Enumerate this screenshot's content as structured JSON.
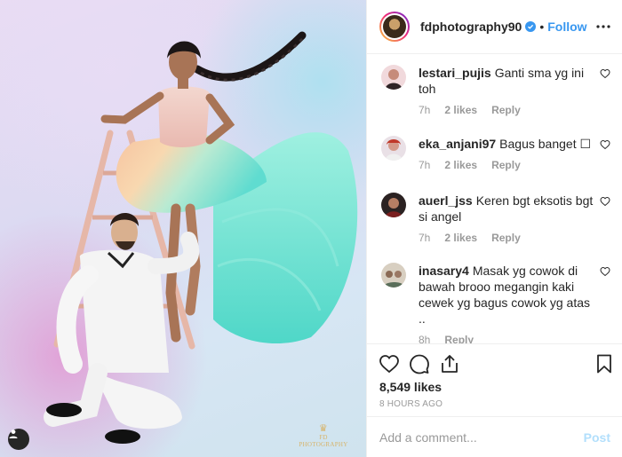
{
  "photo": {
    "alt_icon": "user-tag-icon",
    "watermark_text": "FD PHOTOGRAPHY"
  },
  "header": {
    "username": "fdphotography90",
    "verified_icon": "verified-badge-icon",
    "separator": "•",
    "follow_label": "Follow",
    "more_icon": "more-options-icon"
  },
  "comments": [
    {
      "username": "lestari_pujis",
      "text": "Ganti sma yg ini toh",
      "time": "7h",
      "likes": "2 likes",
      "reply_label": "Reply"
    },
    {
      "username": "eka_anjani97",
      "text": "Bagus banget ☐",
      "time": "7h",
      "likes": "2 likes",
      "reply_label": "Reply"
    },
    {
      "username": "auerl_jss",
      "text": "Keren bgt eksotis bgt si angel",
      "time": "7h",
      "likes": "2 likes",
      "reply_label": "Reply"
    },
    {
      "username": "inasary4",
      "text": "Masak yg cowok di bawah brooo megangin kaki cewek yg bagus cowok yg atas ..",
      "time": "8h",
      "likes": "",
      "reply_label": "Reply"
    }
  ],
  "actions": {
    "like_icon": "heart-icon",
    "comment_icon": "comment-bubble-icon",
    "share_icon": "share-icon",
    "save_icon": "bookmark-icon"
  },
  "likes_count": "8,549 likes",
  "post_time": "8 HOURS AGO",
  "add_comment": {
    "placeholder": "Add a comment...",
    "post_label": "Post"
  },
  "colors": {
    "accent": "#3897f0",
    "post_disabled": "#b2dffc",
    "muted": "#999999",
    "text": "#262626"
  }
}
